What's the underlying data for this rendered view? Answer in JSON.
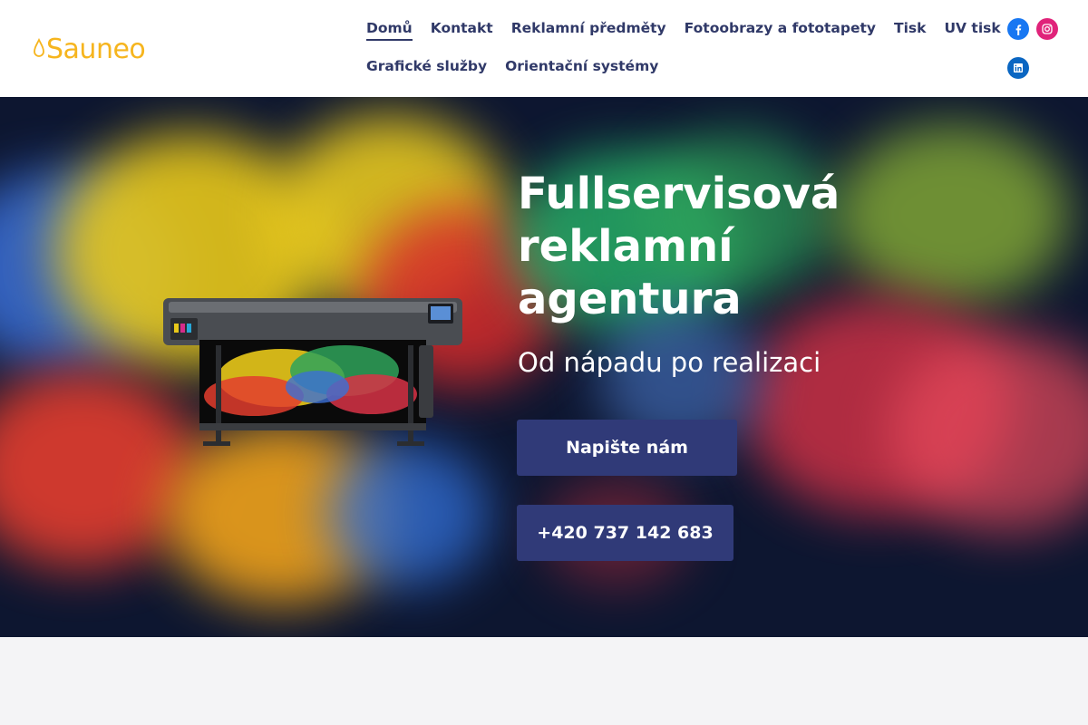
{
  "brand": {
    "name": "Sauneo",
    "logo_color": "#f6b51e"
  },
  "nav": {
    "row1": [
      {
        "label": "Domů",
        "active": true
      },
      {
        "label": "Kontakt"
      },
      {
        "label": "Reklamní předměty"
      },
      {
        "label": "Fotoobrazy a fototapety"
      },
      {
        "label": "Tisk"
      },
      {
        "label": "UV tisk"
      }
    ],
    "row2": [
      {
        "label": "Grafické služby"
      },
      {
        "label": "Orientační systémy"
      }
    ],
    "color": "#303968"
  },
  "social": {
    "facebook": {
      "icon": "facebook-icon",
      "color": "#1877f2"
    },
    "instagram": {
      "icon": "instagram-icon",
      "color": "#e0237a"
    },
    "linkedin": {
      "icon": "linkedin-icon",
      "color": "#0a66c2"
    }
  },
  "hero": {
    "title": "Fullservisová reklamní agentura",
    "subtitle": "Od nápadu po realizaci",
    "cta_primary": "Napište nám",
    "cta_phone": "+420 737 142 683",
    "button_color": "#303a78",
    "background_color": "#0d1630"
  }
}
